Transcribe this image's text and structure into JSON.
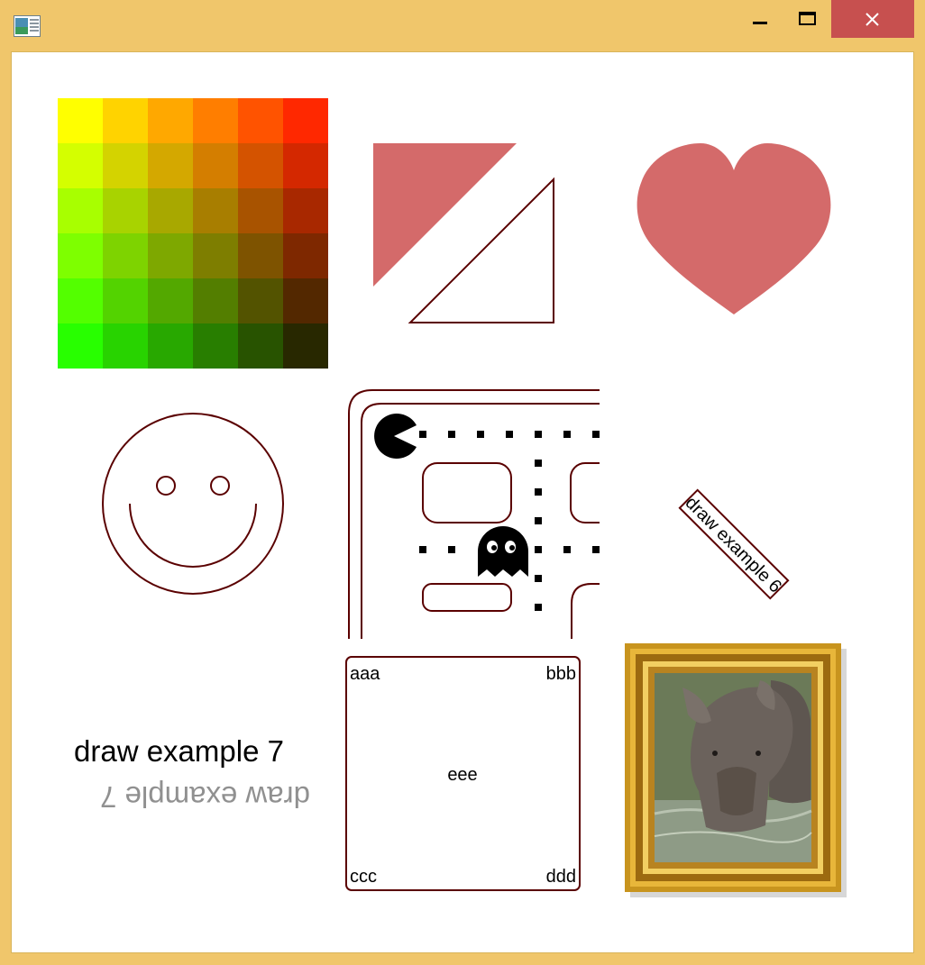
{
  "window": {
    "title_bar_color": "#f0c66b",
    "close_button_color": "#c7504f",
    "icons": [
      "app-icon",
      "minimize-icon",
      "maximize-icon",
      "close-icon"
    ]
  },
  "colors": {
    "outline": "#5a0000",
    "fill_red": "#d46a6a",
    "black": "#000000"
  },
  "palette": {
    "rows": [
      [
        "#ffff00",
        "#ffd300",
        "#ffa800",
        "#ff7e00",
        "#ff5300",
        "#ff2800"
      ],
      [
        "#d4ff00",
        "#d4d300",
        "#d4a800",
        "#d47e00",
        "#d45300",
        "#d42800"
      ],
      [
        "#a8ff00",
        "#a8d300",
        "#a8a800",
        "#a87e00",
        "#a85300",
        "#a82800"
      ],
      [
        "#7eff00",
        "#7ed300",
        "#7ea800",
        "#7e7e00",
        "#7e5300",
        "#7e2800"
      ],
      [
        "#53ff00",
        "#53d300",
        "#53a800",
        "#537e00",
        "#535300",
        "#532800"
      ],
      [
        "#28ff00",
        "#28d300",
        "#28a800",
        "#287e00",
        "#285300",
        "#282800"
      ]
    ]
  },
  "examples": {
    "rotated_label": "draw example 6",
    "heading_text": "draw example 7",
    "corners": {
      "top_left": "aaa",
      "top_right": "bbb",
      "center": "eee",
      "bottom_left": "ccc",
      "bottom_right": "ddd"
    }
  }
}
